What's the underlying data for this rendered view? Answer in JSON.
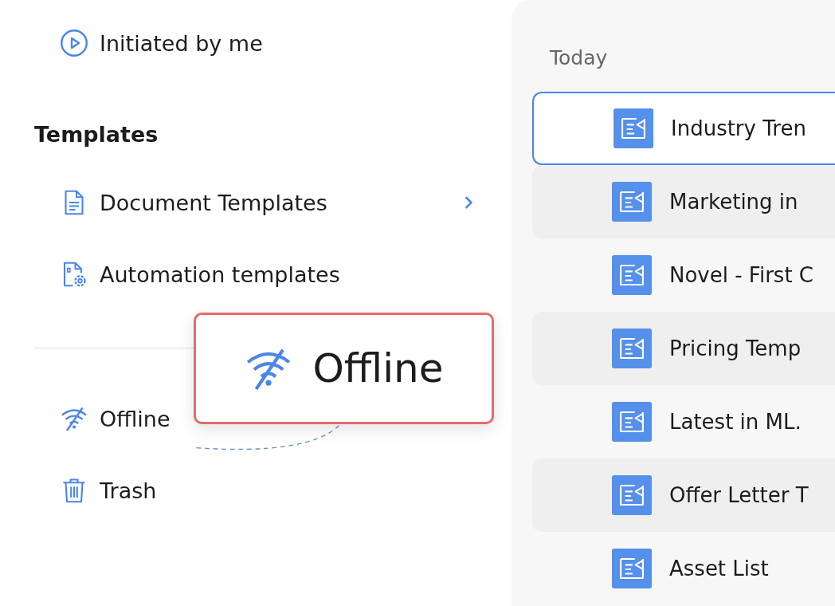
{
  "sidebar": {
    "items": [
      {
        "label": "Initiated by me",
        "kind": "play"
      }
    ],
    "sections": [
      {
        "title": "Templates",
        "items": [
          {
            "label": "Document Templates",
            "kind": "document",
            "has_submenu": true
          },
          {
            "label": "Automation templates",
            "kind": "automation",
            "has_submenu": false
          }
        ]
      }
    ],
    "bottom_items": [
      {
        "label": "Offline",
        "kind": "offline"
      },
      {
        "label": "Trash",
        "kind": "trash"
      }
    ]
  },
  "callout": {
    "label": "Offline"
  },
  "documents": {
    "group": "Today",
    "rows": [
      {
        "title": "Industry Tren",
        "selected": true
      },
      {
        "title": "Marketing in",
        "selected": false
      },
      {
        "title": "Novel - First C",
        "selected": false
      },
      {
        "title": "Pricing Temp",
        "selected": false
      },
      {
        "title": "Latest in ML.",
        "selected": false
      },
      {
        "title": "Offer Letter T",
        "selected": false
      },
      {
        "title": "Asset List",
        "selected": false
      }
    ]
  }
}
